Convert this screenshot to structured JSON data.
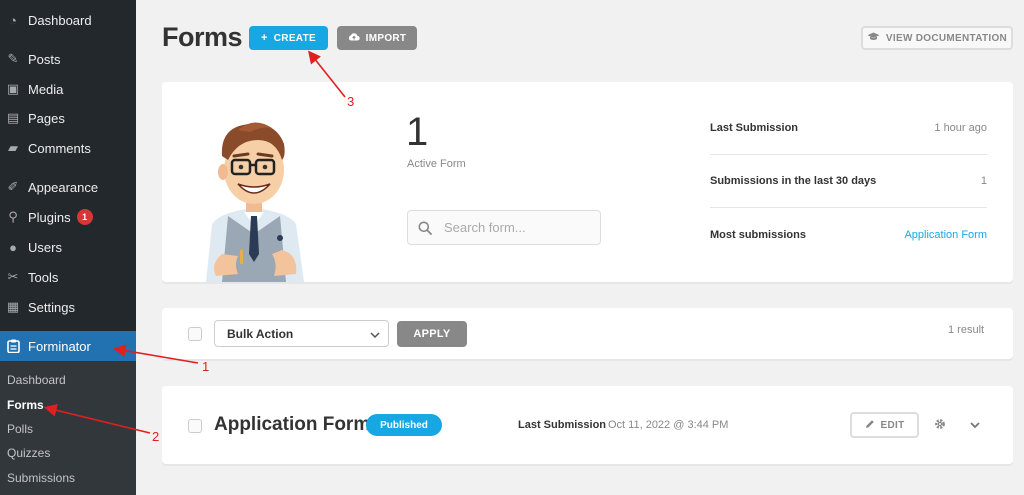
{
  "sidebar": {
    "items": [
      {
        "label": "Dashboard",
        "icon": "dashboard-icon"
      },
      {
        "label": "Posts",
        "icon": "pin-icon"
      },
      {
        "label": "Media",
        "icon": "media-icon"
      },
      {
        "label": "Pages",
        "icon": "pages-icon"
      },
      {
        "label": "Comments",
        "icon": "comments-icon"
      },
      {
        "label": "Appearance",
        "icon": "brush-icon"
      },
      {
        "label": "Plugins",
        "icon": "plugin-icon",
        "badge": "1"
      },
      {
        "label": "Users",
        "icon": "users-icon"
      },
      {
        "label": "Tools",
        "icon": "wrench-icon"
      },
      {
        "label": "Settings",
        "icon": "settings-icon"
      },
      {
        "label": "Forminator",
        "icon": "clipboard-icon",
        "active": true
      }
    ],
    "submenu": [
      "Dashboard",
      "Forms",
      "Polls",
      "Quizzes",
      "Submissions"
    ]
  },
  "header": {
    "title": "Forms",
    "create_label": "CREATE",
    "import_label": "IMPORT",
    "docs_label": "VIEW DOCUMENTATION"
  },
  "summary": {
    "active_count": "1",
    "active_label": "Active Form",
    "search_placeholder": "Search form...",
    "stats": [
      {
        "label": "Last Submission",
        "value": "1 hour ago"
      },
      {
        "label": "Submissions in the last 30 days",
        "value": "1"
      },
      {
        "label": "Most submissions",
        "value": "Application Form"
      }
    ]
  },
  "bulk": {
    "select_value": "Bulk Action",
    "apply_label": "APPLY",
    "result_count": "1 result"
  },
  "form_row": {
    "name": "Application Form",
    "status": "Published",
    "last_submission_label": "Last Submission",
    "last_submission_value": "Oct 11, 2022 @ 3:44 PM",
    "edit_label": "EDIT"
  },
  "annotations": [
    "1",
    "2",
    "3"
  ],
  "colors": {
    "accent": "#17a8e3",
    "wp_blue": "#2271b1",
    "sidebar_bg": "#23282d",
    "annotation_red": "#e02020"
  }
}
